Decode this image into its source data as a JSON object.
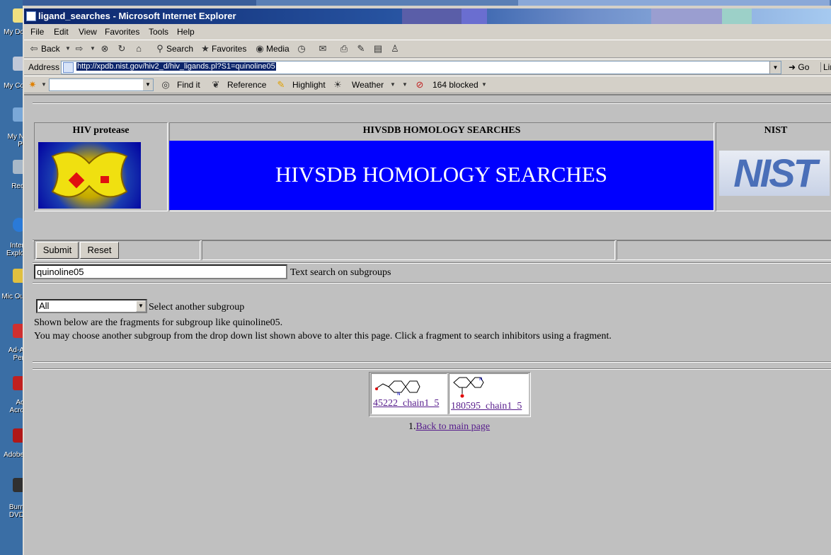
{
  "desktop": {
    "icons": [
      {
        "label": "My Do"
      },
      {
        "label": "My Co"
      },
      {
        "label": "My N Pl"
      },
      {
        "label": "Rec"
      },
      {
        "label": "Inter Explo"
      },
      {
        "label": "Mic Ou"
      },
      {
        "label": "Ad-A Per"
      },
      {
        "label": "Ac Acro"
      },
      {
        "label": "Adobe"
      },
      {
        "label": "Burn DVD"
      }
    ]
  },
  "window": {
    "title": "ligand_searches - Microsoft Internet Explorer"
  },
  "menu": {
    "items": [
      "File",
      "Edit",
      "View",
      "Favorites",
      "Tools",
      "Help"
    ]
  },
  "toolbar": {
    "back": "Back",
    "search": "Search",
    "favorites": "Favorites",
    "media": "Media"
  },
  "address": {
    "label": "Address",
    "url": "http://xpdb.nist.gov/hiv2_d/hiv_ligands.pl?S1=quinoline05",
    "go": "Go",
    "links": "Link"
  },
  "toolbar3": {
    "find": "Find it",
    "reference": "Reference",
    "highlight": "Highlight",
    "weather": "Weather",
    "blocked": "164 blocked"
  },
  "page": {
    "header_left": "HIV protease",
    "header_center": "HIVSDB HOMOLOGY SEARCHES",
    "header_right": "NIST",
    "banner": "HIVSDB HOMOLOGY SEARCHES",
    "nist_logo": "NIST",
    "submit": "Submit",
    "reset": "Reset",
    "search_value": "quinoline05",
    "search_label": "Text search on subgroups",
    "select_value": "All",
    "select_label": "Select another subgroup",
    "info_line1": "Shown below are the fragments for subgroup like quinoline05.",
    "info_line2": "You may choose another subgroup from the drop down list shown above to alter this page. Click a fragment to search inhibitors using a fragment.",
    "fragments": [
      {
        "label": "45222_chain1_5"
      },
      {
        "label": "180595_chain1_5"
      }
    ],
    "back_prefix": "1.",
    "back_link": "Back to main page"
  }
}
